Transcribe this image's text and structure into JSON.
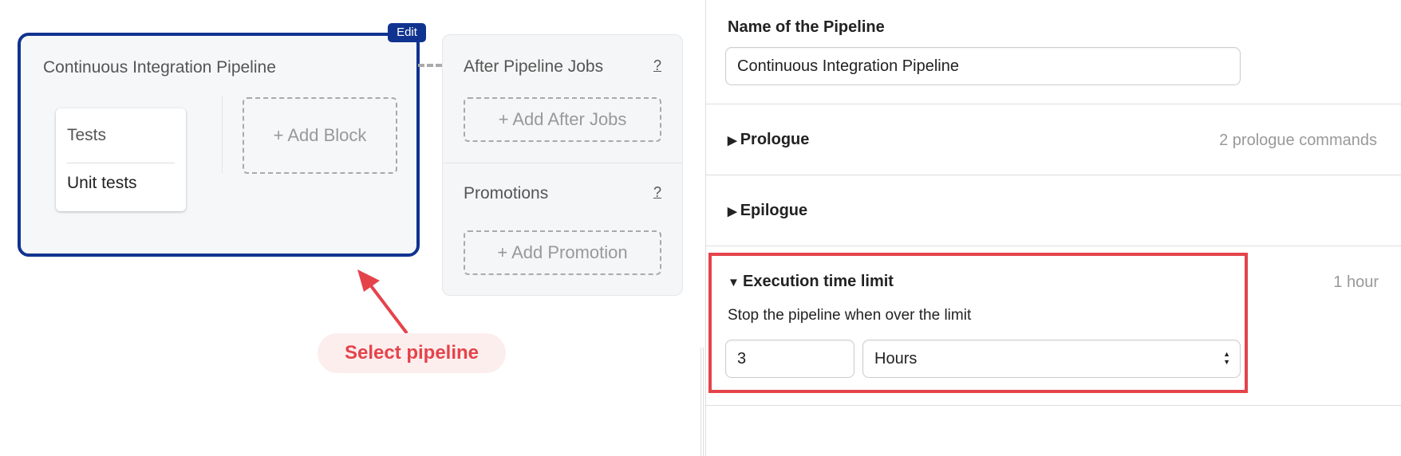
{
  "canvas": {
    "pipeline_title": "Continuous Integration Pipeline",
    "edit_badge": "Edit",
    "block": {
      "name": "Tests",
      "jobs": [
        "Unit tests"
      ]
    },
    "add_block": "+ Add Block",
    "after_pipeline_jobs": {
      "title": "After Pipeline Jobs",
      "help": "?",
      "add": "+ Add After Jobs"
    },
    "promotions": {
      "title": "Promotions",
      "help": "?",
      "add": "+ Add Promotion"
    }
  },
  "annotation": {
    "label": "Select pipeline",
    "color": "#e5434a"
  },
  "panel": {
    "name_label": "Name of the Pipeline",
    "name_value": "Continuous Integration Pipeline",
    "prologue": {
      "label": "Prologue",
      "summary": "2 prologue commands",
      "expanded": false
    },
    "epilogue": {
      "label": "Epilogue",
      "expanded": false
    },
    "execution_time_limit": {
      "label": "Execution time limit",
      "summary": "1 hour",
      "expanded": true,
      "description": "Stop the pipeline when over the limit",
      "value": "3",
      "unit": "Hours"
    }
  },
  "colors": {
    "selected_border": "#10338f",
    "highlight": "#e5434a"
  }
}
